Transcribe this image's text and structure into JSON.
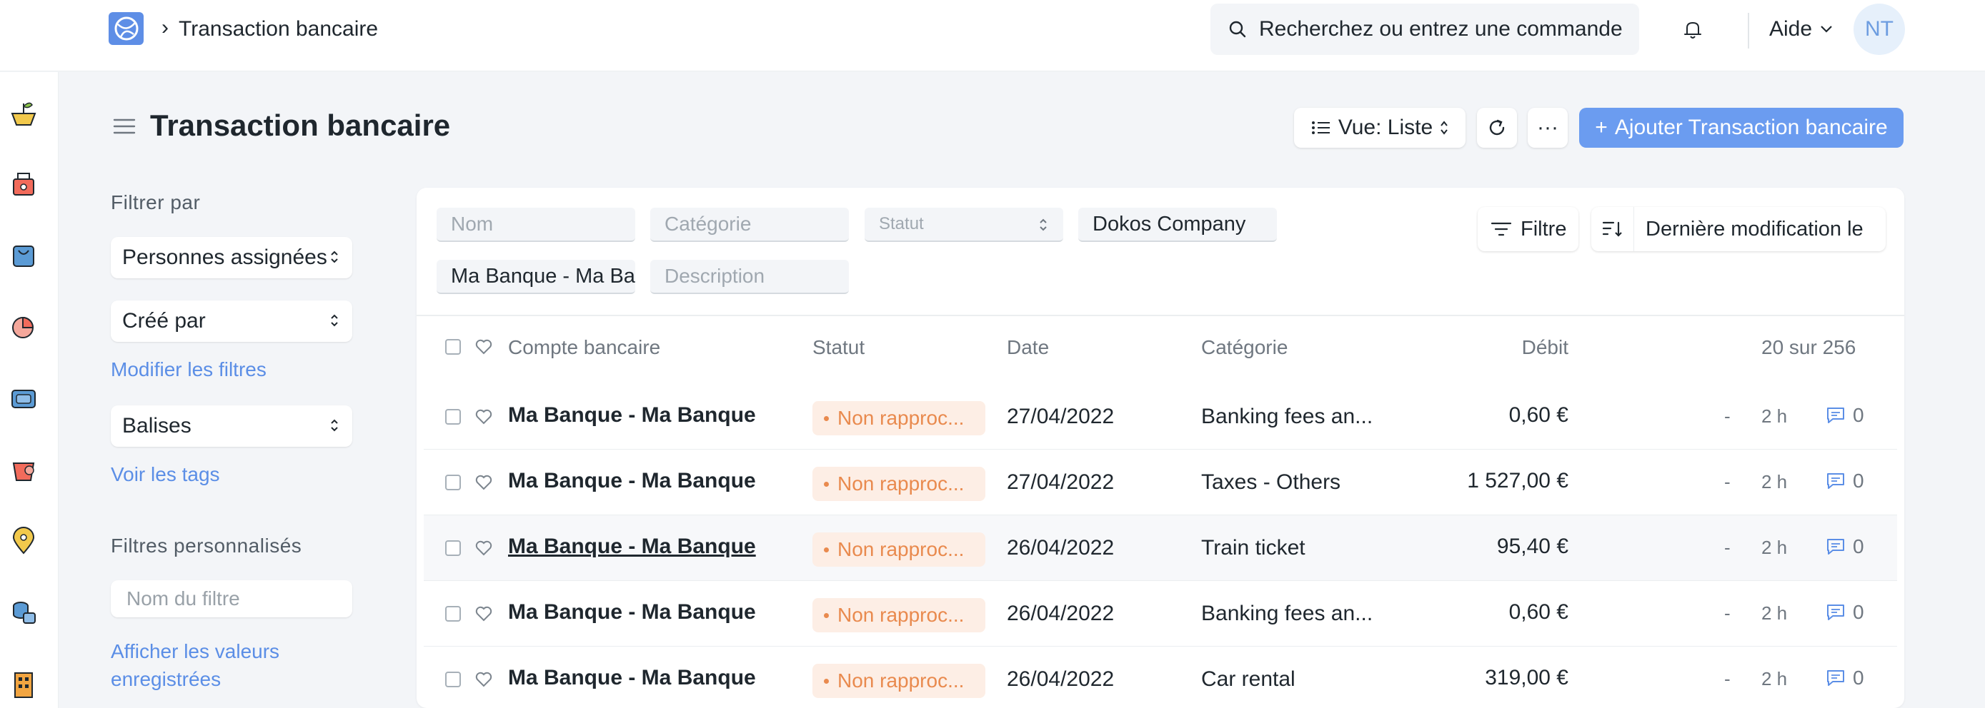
{
  "navbar": {
    "breadcrumb": "Transaction bancaire",
    "search_placeholder": "Recherchez ou entrez une commande",
    "help_label": "Aide",
    "avatar_initials": "NT"
  },
  "page": {
    "title": "Transaction bancaire",
    "view_label": "Vue: Liste",
    "more_label": "···",
    "add_label": "Ajouter Transaction bancaire",
    "add_plus": "+"
  },
  "sidebar": {
    "filter_by": "Filtrer par",
    "assigned": "Personnes assignées",
    "created_by": "Créé par",
    "edit_filters": "Modifier les filtres",
    "tags": "Balises",
    "show_tags": "Voir les tags",
    "custom_filters": "Filtres personnalisés",
    "filter_name_placeholder": "Nom du filtre",
    "show_saved_1": "Afficher les valeurs",
    "show_saved_2": "enregistrées"
  },
  "filters": {
    "name_placeholder": "Nom",
    "category_placeholder": "Catégorie",
    "status_placeholder": "Statut",
    "company_value": "Dokos Company",
    "account_value": "Ma Banque - Ma Banque",
    "description_placeholder": "Description",
    "filter_btn": "Filtre",
    "sort_btn": "Dernière modification le"
  },
  "table": {
    "columns": {
      "account": "Compte bancaire",
      "status": "Statut",
      "date": "Date",
      "category": "Catégorie",
      "debit": "Débit",
      "count": "20 sur 256"
    },
    "rows": [
      {
        "account": "Ma Banque - Ma Banque",
        "status": "Non rapproc...",
        "date": "27/04/2022",
        "category": "Banking fees an...",
        "debit": "0,60 €",
        "dash": "-",
        "time": "2 h",
        "comments": "0"
      },
      {
        "account": "Ma Banque - Ma Banque",
        "status": "Non rapproc...",
        "date": "27/04/2022",
        "category": "Taxes - Others",
        "debit": "1 527,00 €",
        "dash": "-",
        "time": "2 h",
        "comments": "0"
      },
      {
        "account": "Ma Banque - Ma Banque",
        "status": "Non rapproc...",
        "date": "26/04/2022",
        "category": "Train ticket",
        "debit": "95,40 €",
        "dash": "-",
        "time": "2 h",
        "comments": "0"
      },
      {
        "account": "Ma Banque - Ma Banque",
        "status": "Non rapproc...",
        "date": "26/04/2022",
        "category": "Banking fees an...",
        "debit": "0,60 €",
        "dash": "-",
        "time": "2 h",
        "comments": "0"
      },
      {
        "account": "Ma Banque - Ma Banque",
        "status": "Non rapproc...",
        "date": "26/04/2022",
        "category": "Car rental",
        "debit": "319,00 €",
        "dash": "-",
        "time": "2 h",
        "comments": "0"
      }
    ]
  },
  "icons": {
    "logo": "app-logo-icon",
    "search": "search-icon",
    "bell": "bell-icon",
    "chevron": "chevron-down-icon",
    "rail": [
      "plant-icon",
      "cash-register-icon",
      "shopping-bag-icon",
      "pie-chart-icon",
      "wallet-icon",
      "sales-icon",
      "map-pin-icon",
      "database-icon",
      "building-icon"
    ]
  },
  "colors": {
    "primary": "#6b9cf0",
    "link": "#5b8ee6",
    "status_orange": "#e98a4e",
    "status_bg": "#fdeee5"
  }
}
